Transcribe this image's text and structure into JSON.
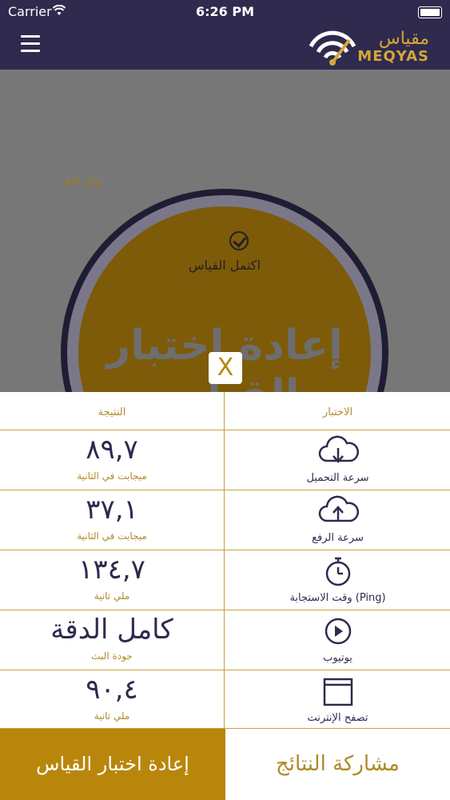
{
  "status_bar": {
    "carrier": "Carrier",
    "time": "6:26 PM"
  },
  "app": {
    "logo_ar": "مقياس",
    "logo_en": "MEQYAS"
  },
  "background": {
    "network_label": "واي فاي",
    "status_text": "اكتمل القياس",
    "retest_text": "إعادة اختبار القياس"
  },
  "close_label": "X",
  "results": {
    "header_test": "الاختبار",
    "header_result": "النتيجة",
    "rows": [
      {
        "label": "سرعة التحميل",
        "value": "٨٩,٧",
        "unit": "ميجابت في الثانية",
        "icon": "cloud-download-icon"
      },
      {
        "label": "سرعة الرفع",
        "value": "٣٧,١",
        "unit": "ميجابت في الثانية",
        "icon": "cloud-upload-icon"
      },
      {
        "label": "وقت الاستجابة (Ping)",
        "value": "١٣٤,٧",
        "unit": "ملي ثانية",
        "icon": "stopwatch-icon"
      },
      {
        "label": "يوتيوب",
        "value": "كامل الدقة",
        "unit": "جودة البث",
        "icon": "play-icon"
      },
      {
        "label": "تصفح الإنترنت",
        "value": "٩٠,٤",
        "unit": "ملي ثانية",
        "icon": "browser-icon"
      }
    ]
  },
  "buttons": {
    "retest": "إعادة اختبار القياس",
    "share": "مشاركة النتائج"
  },
  "colors": {
    "navbar": "#2f2a4e",
    "gold": "#b8860b",
    "accent_text": "#b08a28"
  }
}
